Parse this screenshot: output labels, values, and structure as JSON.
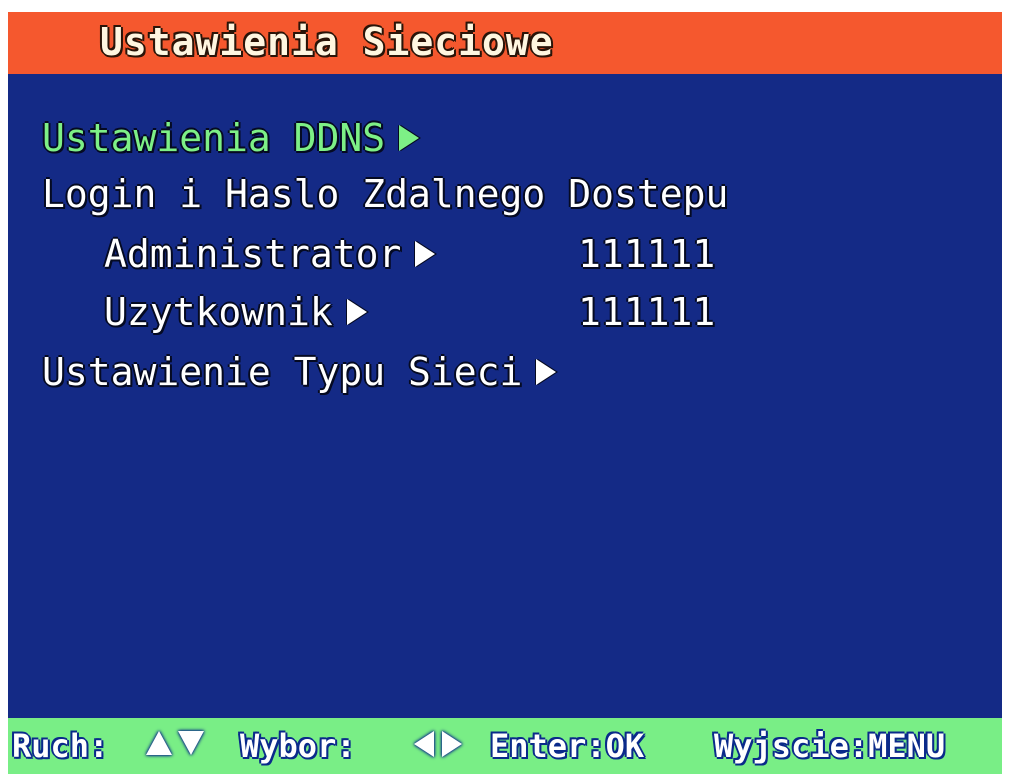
{
  "header": {
    "title": "Ustawienia Sieciowe"
  },
  "menu": {
    "ddns_label": "Ustawienia DDNS",
    "login_heading": "Login i Haslo Zdalnego Dostepu",
    "admin_label": "Administrator",
    "admin_value": "111111",
    "user_label": "Uzytkownik",
    "user_value": "111111",
    "network_type_label": "Ustawienie Typu Sieci"
  },
  "footer": {
    "move_label": "Ruch:",
    "select_label": "Wybor:",
    "enter_label": "Enter:OK",
    "exit_label": "Wyjscie:MENU"
  },
  "icons": {
    "submenu_arrow": "triangle-right-icon",
    "move_up": "triangle-up-icon",
    "move_down": "triangle-down-icon",
    "select_left": "triangle-left-icon",
    "select_right": "triangle-right-icon"
  },
  "colors": {
    "background": "#142a86",
    "title_bar": "#f5582e",
    "footer_bar": "#79ee86",
    "selected_text": "#7df086",
    "text": "#ffffff"
  }
}
